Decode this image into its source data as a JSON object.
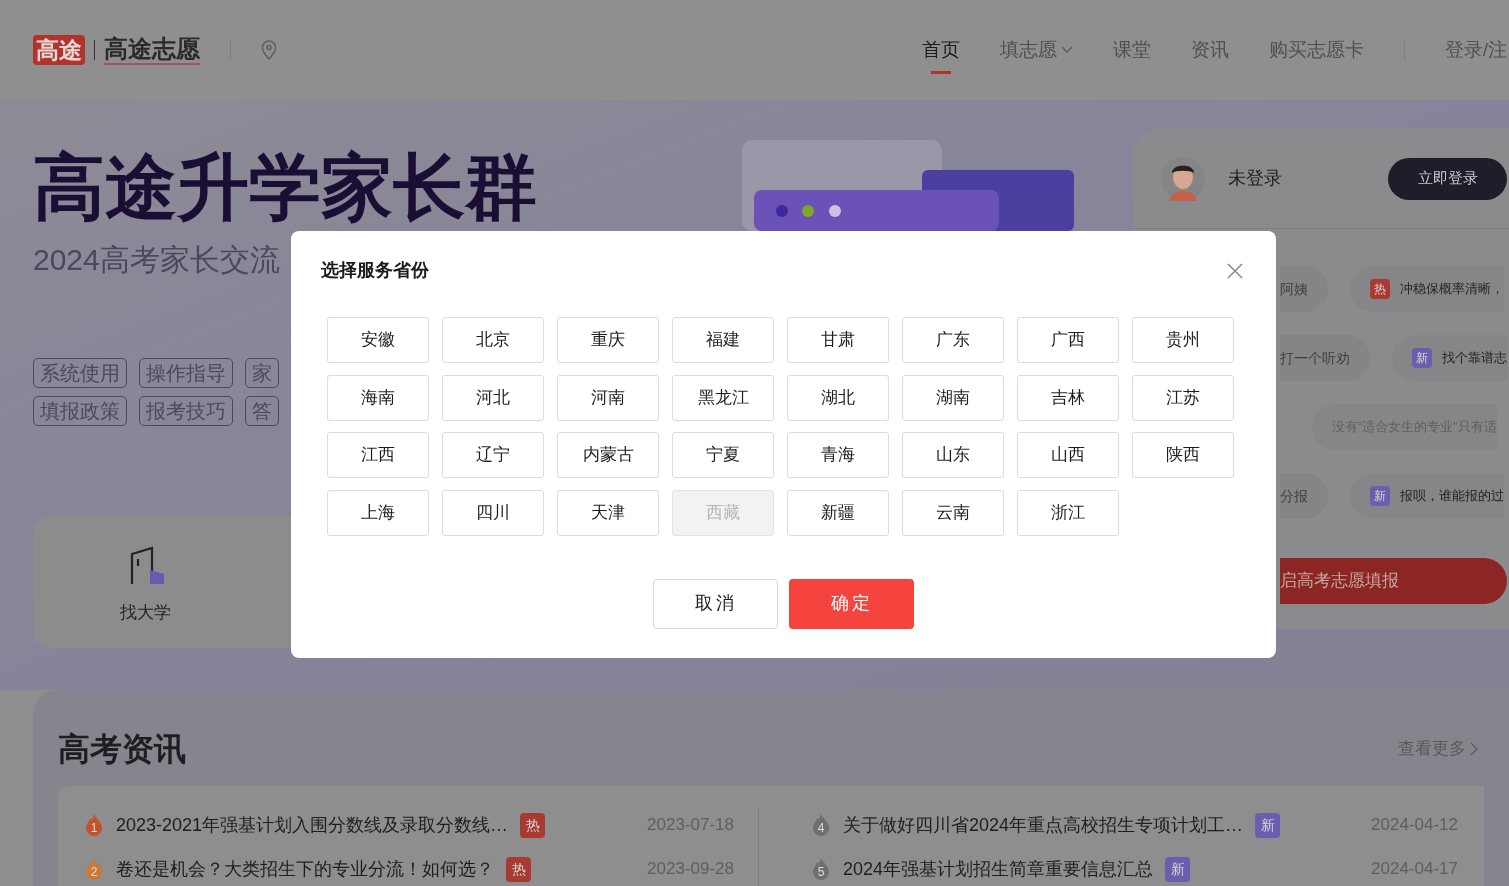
{
  "header": {
    "logo_badge": "高途",
    "logo_text": "高途志愿",
    "nav": [
      {
        "label": "首页",
        "selected": true,
        "dropdown": false
      },
      {
        "label": "填志愿",
        "selected": false,
        "dropdown": true
      },
      {
        "label": "课堂",
        "selected": false,
        "dropdown": false
      },
      {
        "label": "资讯",
        "selected": false,
        "dropdown": false
      },
      {
        "label": "购买志愿卡",
        "selected": false,
        "dropdown": false
      }
    ],
    "login": "登录/注"
  },
  "hero": {
    "title": "高途升学家长群",
    "subtitle": "2024高考家长交流",
    "tags": [
      [
        "系统使用",
        "操作指导",
        "家"
      ],
      [
        "填报政策",
        "报考技巧",
        "答"
      ]
    ],
    "feature_card": {
      "label": "找大学"
    }
  },
  "user_panel": {
    "status": "未登录",
    "login_button": "立即登录",
    "ticker_rows": [
      {
        "left": "阿姨",
        "badge": {
          "kind": "hot",
          "text": "热"
        },
        "text": "冲稳保概率清晰，"
      },
      {
        "left": "打一个听劝",
        "badge": {
          "kind": "new",
          "text": "新"
        },
        "text": "找个靠谱志"
      },
      {
        "left": "",
        "badge": null,
        "text": "没有“适合女生的专业”只有适"
      },
      {
        "left": "分报",
        "badge": {
          "kind": "new",
          "text": "新"
        },
        "text": "报呗，谁能报的过"
      }
    ],
    "cta": "启高考志愿填报"
  },
  "news": {
    "title": "高考资讯",
    "more": "查看更多",
    "columns": [
      [
        {
          "rank": "1",
          "color": "#c4512a",
          "title": "2023-2021年强基计划入围分数线及录取分数线…",
          "badge": {
            "kind": "hot",
            "text": "热"
          },
          "date": "2023-07-18"
        },
        {
          "rank": "2",
          "color": "#c97a3a",
          "title": "卷还是机会？大类招生下的专业分流！如何选？",
          "badge": {
            "kind": "hot",
            "text": "热"
          },
          "date": "2023-09-28"
        }
      ],
      [
        {
          "rank": "4",
          "color": "#6f6f6f",
          "title": "关于做好四川省2024年重点高校招生专项计划工…",
          "badge": {
            "kind": "new",
            "text": "新"
          },
          "date": "2024-04-12"
        },
        {
          "rank": "5",
          "color": "#6f6f6f",
          "title": "2024年强基计划招生简章重要信息汇总",
          "badge": {
            "kind": "new",
            "text": "新"
          },
          "date": "2024-04-17"
        }
      ]
    ]
  },
  "dialog": {
    "title": "选择服务省份",
    "provinces": [
      {
        "name": "安徽",
        "disabled": false
      },
      {
        "name": "北京",
        "disabled": false
      },
      {
        "name": "重庆",
        "disabled": false
      },
      {
        "name": "福建",
        "disabled": false
      },
      {
        "name": "甘肃",
        "disabled": false
      },
      {
        "name": "广东",
        "disabled": false
      },
      {
        "name": "广西",
        "disabled": false
      },
      {
        "name": "贵州",
        "disabled": false
      },
      {
        "name": "海南",
        "disabled": false
      },
      {
        "name": "河北",
        "disabled": false
      },
      {
        "name": "河南",
        "disabled": false
      },
      {
        "name": "黑龙江",
        "disabled": false
      },
      {
        "name": "湖北",
        "disabled": false
      },
      {
        "name": "湖南",
        "disabled": false
      },
      {
        "name": "吉林",
        "disabled": false
      },
      {
        "name": "江苏",
        "disabled": false
      },
      {
        "name": "江西",
        "disabled": false
      },
      {
        "name": "辽宁",
        "disabled": false
      },
      {
        "name": "内蒙古",
        "disabled": false
      },
      {
        "name": "宁夏",
        "disabled": false
      },
      {
        "name": "青海",
        "disabled": false
      },
      {
        "name": "山东",
        "disabled": false
      },
      {
        "name": "山西",
        "disabled": false
      },
      {
        "name": "陕西",
        "disabled": false
      },
      {
        "name": "上海",
        "disabled": false
      },
      {
        "name": "四川",
        "disabled": false
      },
      {
        "name": "天津",
        "disabled": false
      },
      {
        "name": "西藏",
        "disabled": true
      },
      {
        "name": "新疆",
        "disabled": false
      },
      {
        "name": "云南",
        "disabled": false
      },
      {
        "name": "浙江",
        "disabled": false
      }
    ],
    "cancel": "取消",
    "confirm": "确定"
  }
}
